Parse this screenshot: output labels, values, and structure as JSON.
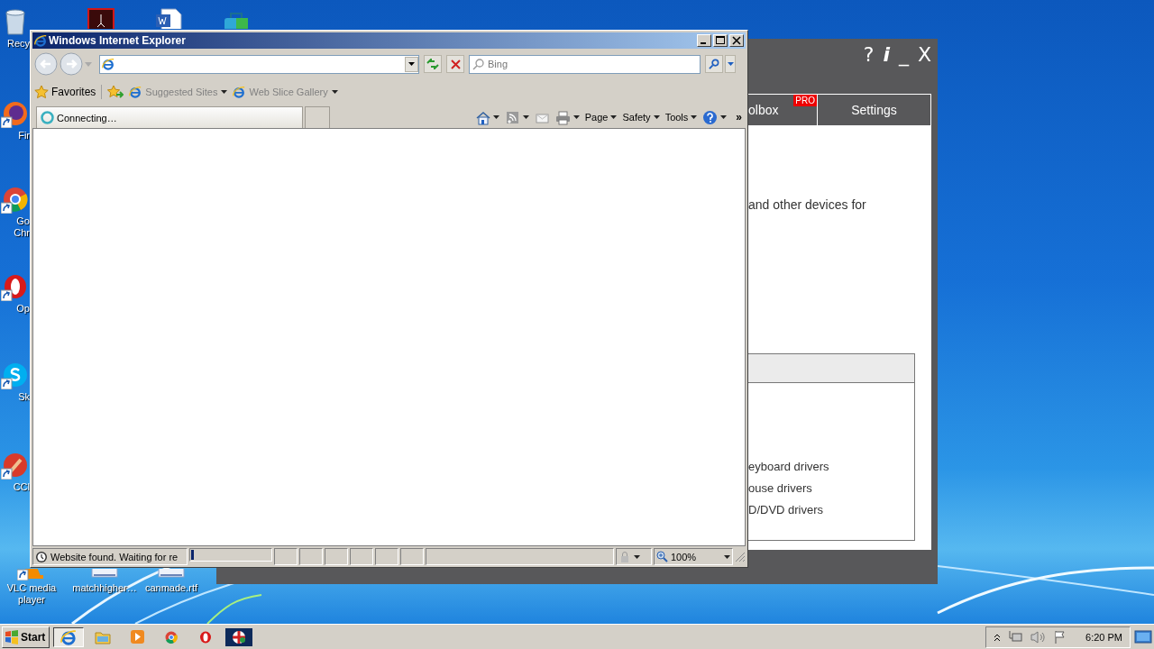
{
  "desktop_icons": [
    {
      "kind": "recycle-bin",
      "label": "Recy",
      "shortcut": false
    },
    {
      "kind": "pdf",
      "shortcut": false
    },
    {
      "kind": "word",
      "shortcut": false
    },
    {
      "kind": "bag",
      "shortcut": false
    },
    {
      "kind": "firefox",
      "label": "Fir",
      "shortcut": true
    },
    {
      "kind": "chrome",
      "label": "Go Chr",
      "shortcut": true
    },
    {
      "kind": "opera",
      "label": "Op",
      "shortcut": true
    },
    {
      "kind": "skype",
      "label": "Sk",
      "shortcut": true
    },
    {
      "kind": "ccleaner",
      "label": "CCl",
      "shortcut": true
    },
    {
      "kind": "vlc",
      "label": "VLC media player",
      "shortcut": true
    },
    {
      "kind": "file",
      "label": "matchhigher…",
      "shortcut": false
    },
    {
      "kind": "file",
      "label": "canmade.rtf",
      "shortcut": false
    }
  ],
  "background_app": {
    "title_buttons": [
      "?",
      "i",
      "_",
      "X"
    ],
    "tabs": [
      {
        "label": "olbox",
        "badge": "PRO",
        "selected": false
      },
      {
        "label": "Settings",
        "selected": false
      }
    ],
    "description": "and other devices for",
    "list_items": [
      "eyboard drivers",
      "ouse drivers",
      "D/DVD drivers"
    ]
  },
  "browser": {
    "title": "Windows Internet Explorer",
    "search": {
      "placeholder": "Bing"
    },
    "favorites": {
      "label": "Favorites",
      "links": [
        {
          "label": "Suggested Sites",
          "disabled": true
        },
        {
          "label": "Web Slice Gallery",
          "disabled": true
        }
      ]
    },
    "tabs": [
      {
        "label": "Connecting…",
        "selected": true
      }
    ],
    "commands": [
      {
        "kind": "home"
      },
      {
        "kind": "feeds"
      },
      {
        "kind": "mail"
      },
      {
        "kind": "print"
      },
      {
        "kind": "menu",
        "label": "Page"
      },
      {
        "kind": "menu",
        "label": "Safety"
      },
      {
        "kind": "menu",
        "label": "Tools"
      },
      {
        "kind": "help"
      },
      {
        "kind": "overflow",
        "label": "»"
      }
    ],
    "status": {
      "text": "Website found. Waiting for re",
      "progress": {
        "level": 0.02
      },
      "zoom": "100%"
    }
  },
  "taskbar": {
    "start": "Start",
    "apps": [
      {
        "kind": "ie",
        "selected": true
      },
      {
        "kind": "folder",
        "selected": false
      },
      {
        "kind": "media",
        "selected": false
      },
      {
        "kind": "chrome",
        "selected": false
      },
      {
        "kind": "opera",
        "selected": false
      },
      {
        "kind": "app",
        "selected": false
      }
    ],
    "clock": "6:20 PM"
  }
}
